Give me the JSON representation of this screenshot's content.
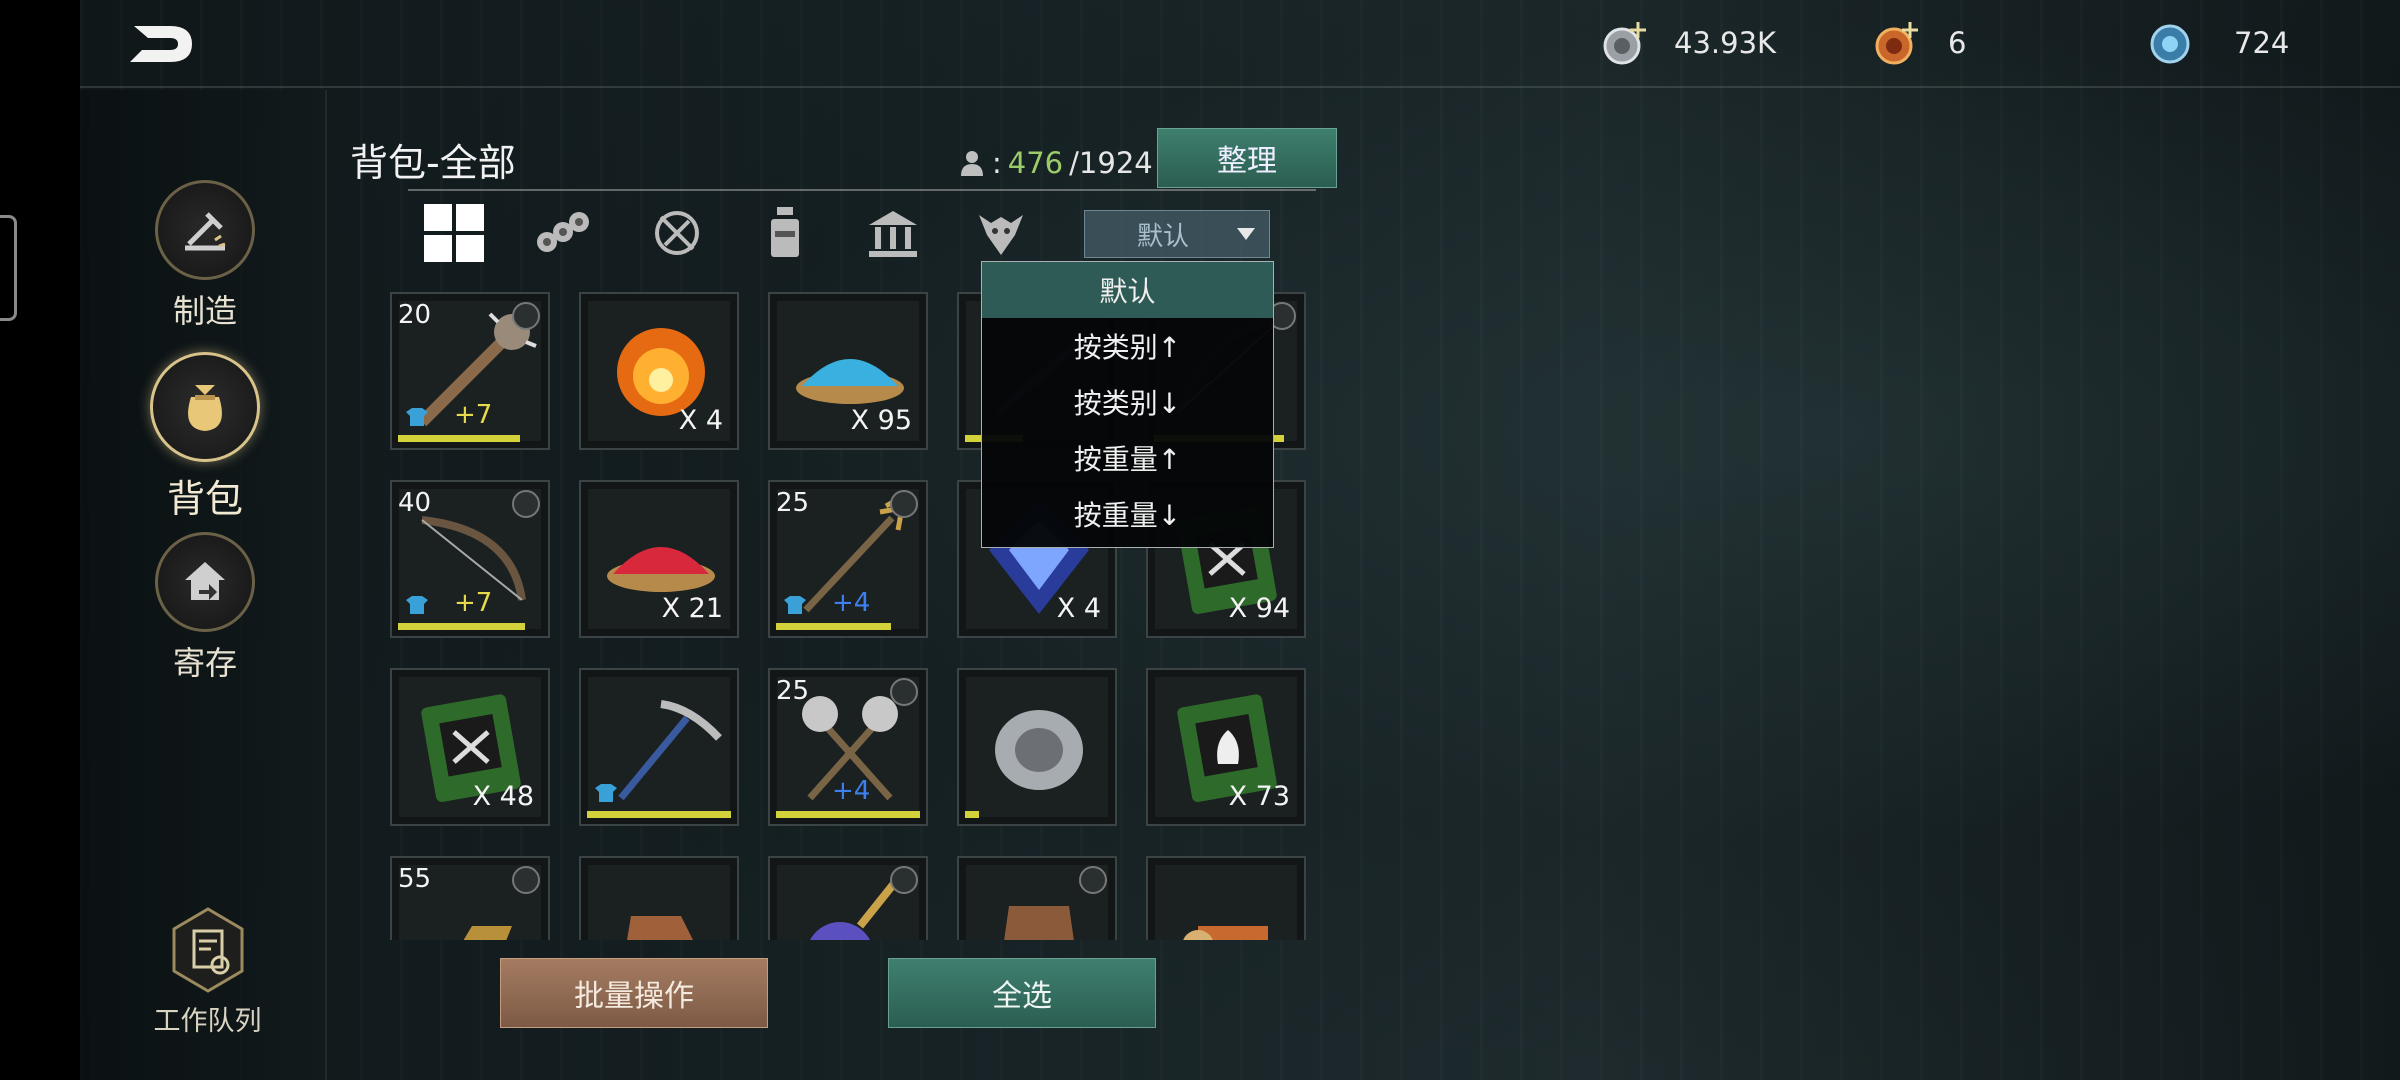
{
  "resources": [
    {
      "icon": "silver-coin-icon",
      "value": "43.93K",
      "addable": true
    },
    {
      "icon": "gold-medal-icon",
      "value": "6",
      "addable": true
    },
    {
      "icon": "blue-gem-icon",
      "value": "724",
      "addable": false
    }
  ],
  "sidebar": {
    "items": [
      {
        "label": "制造",
        "icon": "crafting-hammer-icon"
      },
      {
        "label": "背包",
        "icon": "bag-icon",
        "active": true
      },
      {
        "label": "寄存",
        "icon": "storage-house-icon"
      }
    ],
    "work_queue": "工作队列"
  },
  "inventory": {
    "title": "背包-全部",
    "capacity_current": "476",
    "capacity_total": "/1924",
    "sort_button": "整理",
    "categories": [
      "all-grid-icon",
      "materials-logs-icon",
      "no-weapon-icon",
      "potion-bottle-icon",
      "building-icon",
      "creature-icon"
    ],
    "sort_selected": "默认",
    "sort_menu": [
      "默认",
      "按类别↑",
      "按类别↓",
      "按重量↑",
      "按重量↓"
    ],
    "slots": [
      {
        "name": "spiked-club",
        "level": "20",
        "plus": "+7",
        "plus_color": "y",
        "qty": "",
        "durability": 0.85,
        "linked": true,
        "equip": true
      },
      {
        "name": "fire-essence",
        "level": "",
        "plus": "",
        "qty": "X 4",
        "durability": null,
        "linked": false,
        "equip": false
      },
      {
        "name": "blue-powder",
        "level": "",
        "plus": "",
        "qty": "X 95",
        "durability": null,
        "linked": false,
        "equip": false
      },
      {
        "name": "hidden-item-1",
        "level": "",
        "plus": "",
        "qty": "",
        "durability": 0.4,
        "linked": false,
        "equip": false
      },
      {
        "name": "dark-bow",
        "level": "",
        "plus": "",
        "qty": "",
        "durability": 0.9,
        "linked": true,
        "equip": false
      },
      {
        "name": "recurve-bow",
        "level": "40",
        "plus": "+7",
        "plus_color": "y",
        "qty": "",
        "durability": 0.88,
        "linked": true,
        "equip": true
      },
      {
        "name": "red-powder",
        "level": "",
        "plus": "",
        "qty": "X 21",
        "durability": null,
        "linked": false,
        "equip": false
      },
      {
        "name": "trident-spear",
        "level": "25",
        "plus": "+4",
        "plus_color": "b",
        "qty": "",
        "durability": 0.8,
        "linked": true,
        "equip": true
      },
      {
        "name": "blue-crystal",
        "level": "",
        "plus": "",
        "qty": "X 4",
        "durability": null,
        "linked": false,
        "equip": false
      },
      {
        "name": "green-book",
        "level": "",
        "plus": "",
        "qty": "X 94",
        "durability": null,
        "linked": false,
        "equip": false
      },
      {
        "name": "green-book",
        "level": "",
        "plus": "",
        "qty": "X 48",
        "durability": null,
        "linked": false,
        "equip": false
      },
      {
        "name": "pickaxe",
        "level": "",
        "plus": "",
        "qty": "",
        "durability": 1.0,
        "linked": false,
        "equip": true
      },
      {
        "name": "double-axe",
        "level": "25",
        "plus": "+4",
        "plus_color": "b",
        "qty": "",
        "durability": 1.0,
        "linked": true,
        "equip": false
      },
      {
        "name": "silver-ore",
        "level": "",
        "plus": "",
        "qty": "",
        "durability": 0.1,
        "linked": false,
        "equip": false
      },
      {
        "name": "green-fire-book",
        "level": "",
        "plus": "",
        "qty": "X 73",
        "durability": null,
        "linked": false,
        "equip": false
      },
      {
        "name": "golden-gauntlet",
        "level": "55",
        "plus": "",
        "qty": "",
        "durability": null,
        "linked": true,
        "equip": false
      },
      {
        "name": "leather-boots",
        "level": "",
        "plus": "",
        "qty": "",
        "durability": null,
        "linked": false,
        "equip": false
      },
      {
        "name": "arcane-staff",
        "level": "",
        "plus": "",
        "qty": "",
        "durability": null,
        "linked": true,
        "equip": false
      },
      {
        "name": "armor-piece",
        "level": "",
        "plus": "",
        "qty": "",
        "durability": null,
        "linked": true,
        "equip": false
      },
      {
        "name": "scroll-item",
        "level": "",
        "plus": "",
        "qty": "",
        "durability": null,
        "linked": false,
        "equip": false
      }
    ],
    "batch_button": "批量操作",
    "select_all_button": "全选"
  }
}
